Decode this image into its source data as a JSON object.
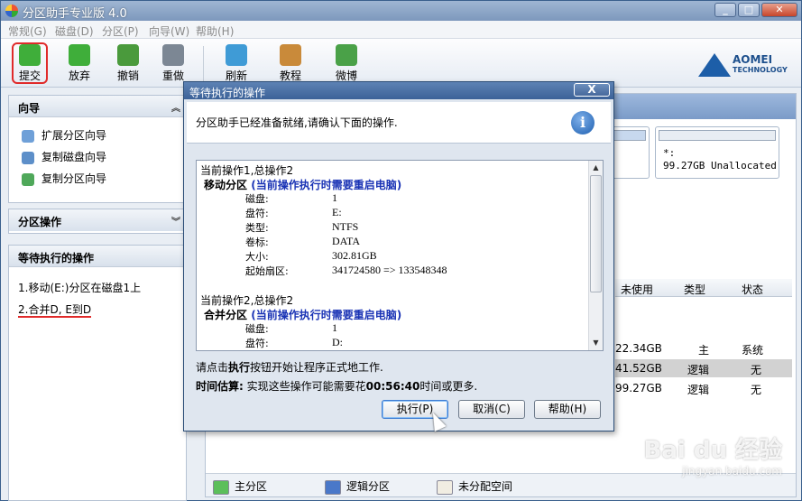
{
  "window": {
    "title": "分区助手专业版 4.0"
  },
  "menu": [
    "常规(G)",
    "磁盘(D)",
    "分区(P)",
    "向导(W)",
    "帮助(H)"
  ],
  "toolbar": {
    "submit": "提交",
    "discard": "放弃",
    "undo": "撤销",
    "redo": "重做",
    "refresh": "刷新",
    "tutorial": "教程",
    "weibo": "微博"
  },
  "logo": {
    "line1": "AOMEI",
    "line2": "TECHNOLOGY"
  },
  "wizard": {
    "title": "向导",
    "items": [
      "扩展分区向导",
      "复制磁盘向导",
      "复制分区向导"
    ]
  },
  "partition_ops": {
    "title": "分区操作"
  },
  "pending": {
    "title": "等待执行的操作",
    "items": [
      "1.移动(E:)分区在磁盘1上",
      "2.合并D, E到D"
    ]
  },
  "disk_map": {
    "unalloc_name": "*:",
    "unalloc_size": "99.27GB Unallocated"
  },
  "table": {
    "headers": [
      "未使用",
      "类型",
      "状态"
    ],
    "rows": [
      {
        "free": "22.34GB",
        "type": "主",
        "status": "系统"
      },
      {
        "free": "41.52GB",
        "type": "逻辑",
        "status": "无"
      },
      {
        "free": "99.27GB",
        "type": "逻辑",
        "status": "无"
      }
    ]
  },
  "legend": [
    "主分区",
    "逻辑分区",
    "未分配空间"
  ],
  "dialog": {
    "title": "等待执行的操作",
    "close": "X",
    "message": "分区助手已经准备就绪,请确认下面的操作.",
    "info_glyph": "i",
    "op1": {
      "head": "当前操作1,总操作2",
      "title": "移动分区",
      "warning": "(当前操作执行时需要重启电脑)",
      "rows": [
        {
          "k": "磁盘:",
          "v": "1"
        },
        {
          "k": "盘符:",
          "v": "E:"
        },
        {
          "k": "类型:",
          "v": "NTFS"
        },
        {
          "k": "卷标:",
          "v": "DATA"
        },
        {
          "k": "大小:",
          "v": "302.81GB"
        },
        {
          "k": "起始扇区:",
          "v": "341724580 => 133548348"
        }
      ]
    },
    "op2": {
      "head": "当前操作2,总操作2",
      "title": "合并分区",
      "warning": "(当前操作执行时需要重启电脑)",
      "rows": [
        {
          "k": "磁盘:",
          "v": "1"
        },
        {
          "k": "盘符:",
          "v": "D:"
        }
      ]
    },
    "hint_pre": "请点击",
    "hint_bold": "执行",
    "hint_post": "按钮开始让程序正式地工作.",
    "est_label": "时间估算:",
    "est_pre": " 实现这些操作可能需要花",
    "est_time": "00:56:40",
    "est_post": "时间或更多.",
    "buttons": {
      "execute": "执行(P)",
      "cancel": "取消(C)",
      "help": "帮助(H)"
    }
  },
  "watermark": {
    "main": "Bai du 经验",
    "sub": "jingyan.baidu.com"
  },
  "colors": {
    "accent": "#3c6298",
    "warning_text": "#1a33b5",
    "highlight_box": "#e02a2a"
  }
}
